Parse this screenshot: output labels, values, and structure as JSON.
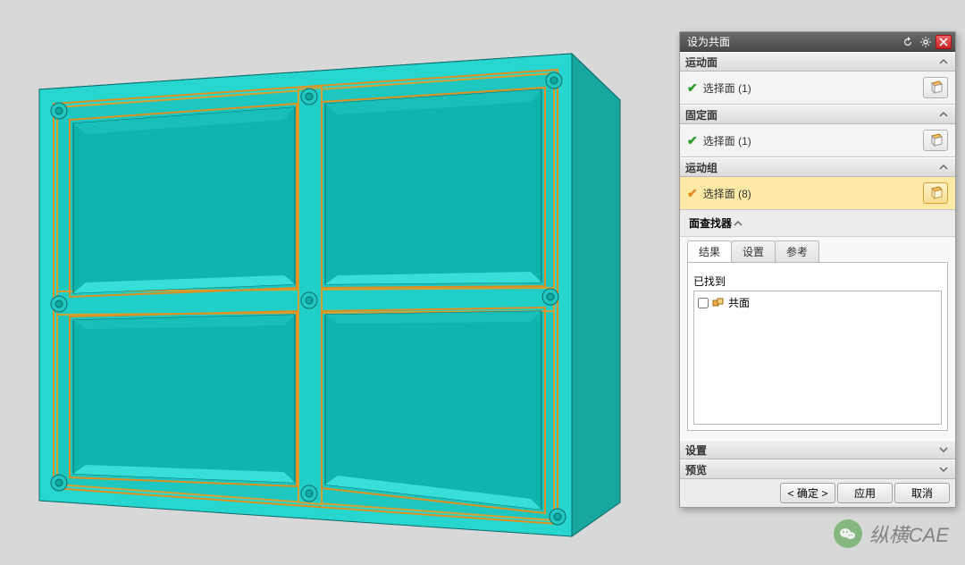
{
  "dialog": {
    "title": "设为共面",
    "sections": {
      "motion_face": {
        "header": "运动面",
        "row_label": "选择面 (1)"
      },
      "fixed_face": {
        "header": "固定面",
        "row_label": "选择面 (1)"
      },
      "motion_group": {
        "header": "运动组",
        "row_label": "选择面 (8)"
      }
    },
    "finder": {
      "header": "面查找器",
      "tabs": {
        "results": "结果",
        "settings": "设置",
        "reference": "参考"
      },
      "found_label": "已找到",
      "item": "共面"
    },
    "extra_sections": {
      "settings": "设置",
      "preview": "预览"
    },
    "buttons": {
      "ok": "< 确定 >",
      "apply": "应用",
      "cancel": "取消"
    }
  },
  "watermark": "纵横CAE"
}
